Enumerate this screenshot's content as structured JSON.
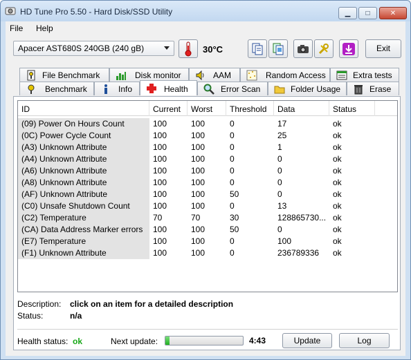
{
  "window": {
    "title": "HD Tune Pro 5.50 - Hard Disk/SSD Utility"
  },
  "menu": {
    "file": "File",
    "help": "Help"
  },
  "toolbar": {
    "drive": "Apacer AST680S 240GB (240 gB)",
    "temperature": "30°C",
    "exit_label": "Exit"
  },
  "tabs_top": [
    "File Benchmark",
    "Disk monitor",
    "AAM",
    "Random Access",
    "Extra tests"
  ],
  "tabs_bottom": [
    "Benchmark",
    "Info",
    "Health",
    "Error Scan",
    "Folder Usage",
    "Erase"
  ],
  "active_tab": "Health",
  "smart": {
    "columns": [
      "ID",
      "Current",
      "Worst",
      "Threshold",
      "Data",
      "Status"
    ],
    "rows": [
      [
        "(09) Power On Hours Count",
        "100",
        "100",
        "0",
        "17",
        "ok"
      ],
      [
        "(0C) Power Cycle Count",
        "100",
        "100",
        "0",
        "25",
        "ok"
      ],
      [
        "(A3) Unknown Attribute",
        "100",
        "100",
        "0",
        "1",
        "ok"
      ],
      [
        "(A4) Unknown Attribute",
        "100",
        "100",
        "0",
        "0",
        "ok"
      ],
      [
        "(A6) Unknown Attribute",
        "100",
        "100",
        "0",
        "0",
        "ok"
      ],
      [
        "(A8) Unknown Attribute",
        "100",
        "100",
        "0",
        "0",
        "ok"
      ],
      [
        "(AF) Unknown Attribute",
        "100",
        "100",
        "50",
        "0",
        "ok"
      ],
      [
        "(C0) Unsafe Shutdown Count",
        "100",
        "100",
        "0",
        "13",
        "ok"
      ],
      [
        "(C2) Temperature",
        "70",
        "70",
        "30",
        "128865730...",
        "ok"
      ],
      [
        "(CA) Data Address Marker errors",
        "100",
        "100",
        "50",
        "0",
        "ok"
      ],
      [
        "(E7) Temperature",
        "100",
        "100",
        "0",
        "100",
        "ok"
      ],
      [
        "(F1) Unknown Attribute",
        "100",
        "100",
        "0",
        "236789336",
        "ok"
      ]
    ]
  },
  "details": {
    "description_label": "Description:",
    "description_value": "click on an item for a detailed description",
    "status_label": "Status:",
    "status_value": "n/a"
  },
  "footer": {
    "health_label": "Health status:",
    "health_value": "ok",
    "next_update_label": "Next update:",
    "next_update_progress": 0.05,
    "countdown": "4:43",
    "update_button": "Update",
    "log_button": "Log"
  },
  "colors": {
    "health_ok": "#18a818",
    "accent": "#cfe0f2"
  }
}
